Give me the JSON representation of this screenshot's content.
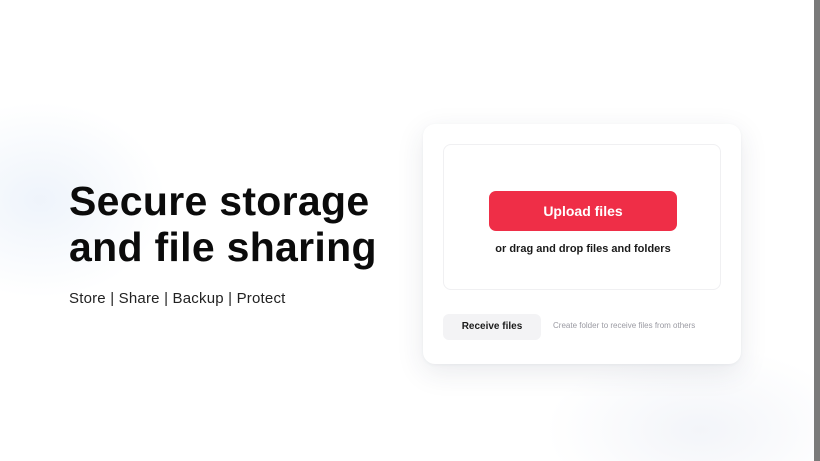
{
  "hero": {
    "title": "Secure storage\nand file sharing",
    "tagline": "Store  |  Share  |  Backup  |  Protect"
  },
  "upload_card": {
    "upload_label": "Upload files",
    "drop_hint": "or drag and drop files and folders",
    "receive_label": "Receive files",
    "receive_hint": "Create folder to receive files from others"
  },
  "colors": {
    "accent": "#ef2e47",
    "text": "#0b0b0b",
    "muted": "#9a9aa2"
  }
}
